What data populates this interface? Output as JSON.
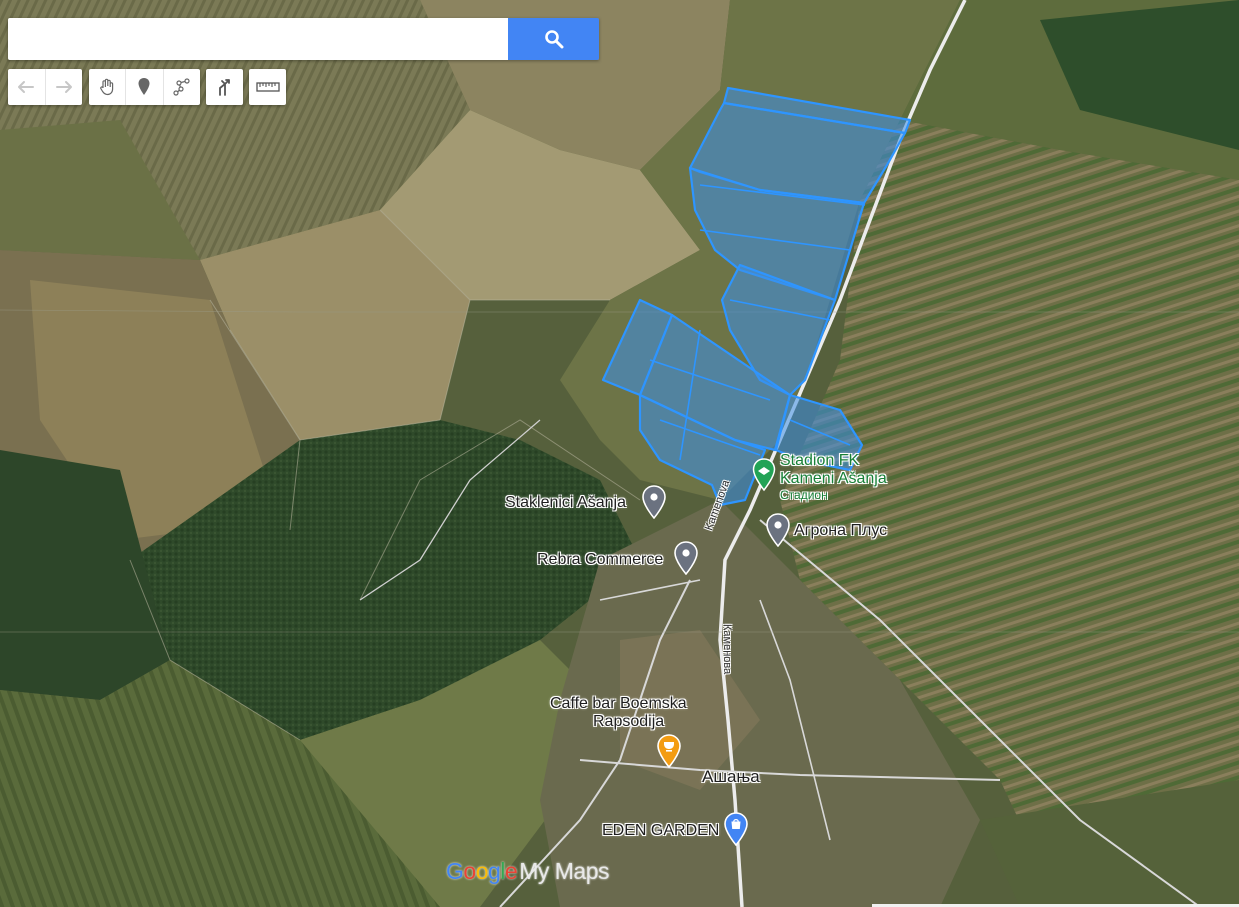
{
  "search": {
    "placeholder": "",
    "value": ""
  },
  "toolbar": {
    "undo": "undo-icon",
    "redo": "redo-icon",
    "pan": "hand-icon",
    "add_marker": "marker-icon",
    "draw_line": "draw-line-icon",
    "directions": "route-icon",
    "measure": "ruler-icon"
  },
  "places": {
    "stadium": {
      "name_line1": "Stadion FK",
      "name_line2": "Kameni Ašanja",
      "category": "Стадион"
    },
    "staklenici": "Staklenici Ašanja",
    "agrona": "Агрона Плус",
    "rebra": "Rebra Commerce",
    "caffe_line1": "Caffe bar Boemska",
    "caffe_line2": "Rapsodija",
    "village": "Ашања",
    "eden": "EDEN GARDEN"
  },
  "roads": {
    "road_latin": "Kamenova",
    "road_cyrillic": "Каменова"
  },
  "branding": {
    "google": [
      "G",
      "o",
      "o",
      "g",
      "l",
      "e"
    ],
    "product": "My Maps"
  },
  "colors": {
    "polygon_fill": "#3d8fe8",
    "polygon_stroke": "#2e95ff",
    "search_button": "#4285f4",
    "stadium_marker": "#22a356",
    "cafe_marker": "#f39c12",
    "shop_marker": "#4285f4",
    "pin_marker": "#6b7280"
  }
}
